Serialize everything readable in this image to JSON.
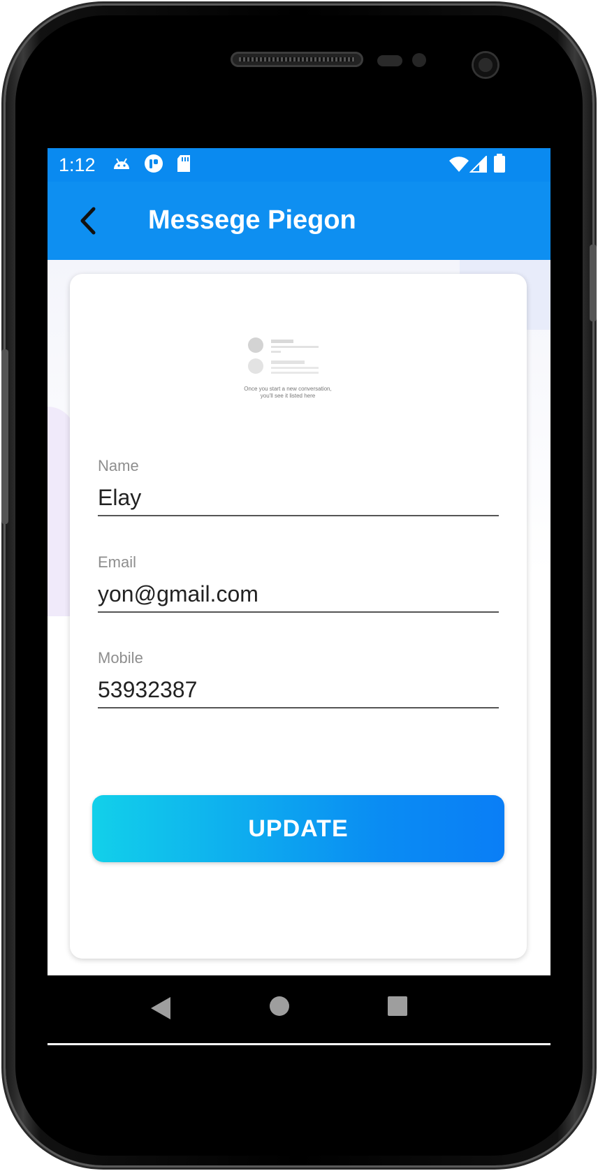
{
  "status_bar": {
    "time": "1:12",
    "icons": [
      "android-icon",
      "app-notification-icon",
      "sd-card-icon",
      "wifi-icon",
      "cell-signal-icon",
      "battery-icon"
    ]
  },
  "app_bar": {
    "title": "Messege Piegon",
    "back_icon": "back-arrow-icon"
  },
  "illustration": {
    "caption_line1": "Once you start a new conversation,",
    "caption_line2": "you'll see it listed here"
  },
  "form": {
    "name_label": "Name",
    "name_value": "Elay",
    "email_label": "Email",
    "email_value": "yon@gmail.com",
    "mobile_label": "Mobile",
    "mobile_value": "53932387",
    "update_label": "UPDATE"
  },
  "nav_bar": {
    "back_icon": "nav-back-icon",
    "home_icon": "nav-home-icon",
    "recents_icon": "nav-recents-icon"
  },
  "colors": {
    "primary": "#0e8ff1",
    "button_gradient_start": "#12d0ea",
    "button_gradient_end": "#0a7ef6"
  }
}
